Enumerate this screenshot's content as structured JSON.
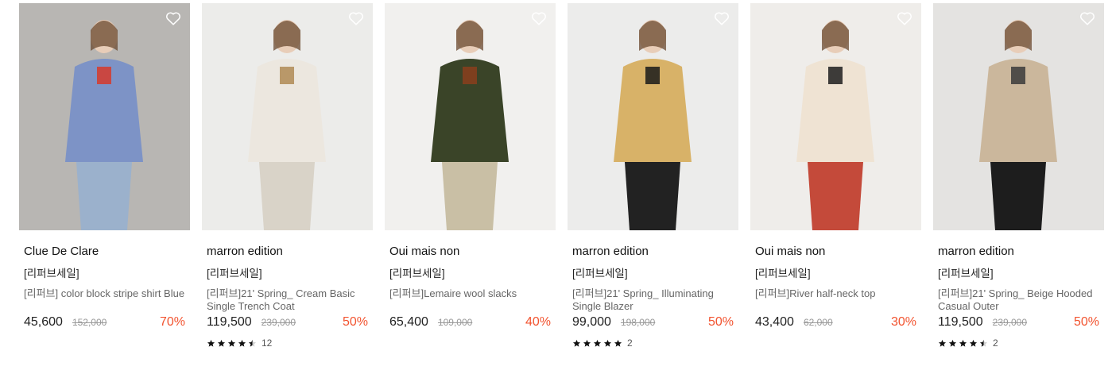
{
  "products": [
    {
      "brand": "Clue De Clare",
      "tag": "[리퍼브세일]",
      "name": "[리퍼브] color block stripe shirt Blue",
      "price": "45,600",
      "original_price": "152,000",
      "discount": "70%",
      "rating_stars": 0,
      "review_count": "",
      "image": {
        "bg": "#b8b6b3",
        "subject": "#7d93c6",
        "accent": "#d63a2a",
        "legs": "#9bb1cc"
      }
    },
    {
      "brand": "marron edition",
      "tag": "[리퍼브세일]",
      "name": "[리퍼브]21' Spring_ Cream Basic Single Trench Coat",
      "price": "119,500",
      "original_price": "239,000",
      "discount": "50%",
      "rating_stars": 4.5,
      "review_count": "12",
      "image": {
        "bg": "#ececea",
        "subject": "#ece7df",
        "accent": "#b08a55",
        "legs": "#d9d3c8"
      }
    },
    {
      "brand": "Oui mais non",
      "tag": "[리퍼브세일]",
      "name": "[리퍼브]Lemaire wool slacks",
      "price": "65,400",
      "original_price": "109,000",
      "discount": "40%",
      "rating_stars": 0,
      "review_count": "",
      "image": {
        "bg": "#f1f0ee",
        "subject": "#3a4428",
        "accent": "#8b3e1c",
        "legs": "#c9bfa5"
      }
    },
    {
      "brand": "marron edition",
      "tag": "[리퍼브세일]",
      "name": "[리퍼브]21' Spring_ Illuminating Single Blazer",
      "price": "99,000",
      "original_price": "198,000",
      "discount": "50%",
      "rating_stars": 5,
      "review_count": "2",
      "image": {
        "bg": "#ececeb",
        "subject": "#d8b268",
        "accent": "#1a1a1a",
        "legs": "#222222"
      }
    },
    {
      "brand": "Oui mais non",
      "tag": "[리퍼브세일]",
      "name": "[리퍼브]River half-neck top",
      "price": "43,400",
      "original_price": "62,000",
      "discount": "30%",
      "rating_stars": 0,
      "review_count": "",
      "image": {
        "bg": "#efedea",
        "subject": "#efe3d3",
        "accent": "#1d1d1d",
        "legs": "#c44a3a"
      }
    },
    {
      "brand": "marron edition",
      "tag": "[리퍼브세일]",
      "name": "[리퍼브]21' Spring_ Beige Hooded Casual Outer",
      "price": "119,500",
      "original_price": "239,000",
      "discount": "50%",
      "rating_stars": 4.5,
      "review_count": "2",
      "image": {
        "bg": "#e4e3e1",
        "subject": "#cbb79c",
        "accent": "#3b3b3b",
        "legs": "#1d1d1d"
      }
    }
  ],
  "icons": {
    "wishlist": "heart-outline-icon",
    "rating": "star-icon"
  },
  "colors": {
    "discount": "#f2532f",
    "original_price": "#999999"
  }
}
